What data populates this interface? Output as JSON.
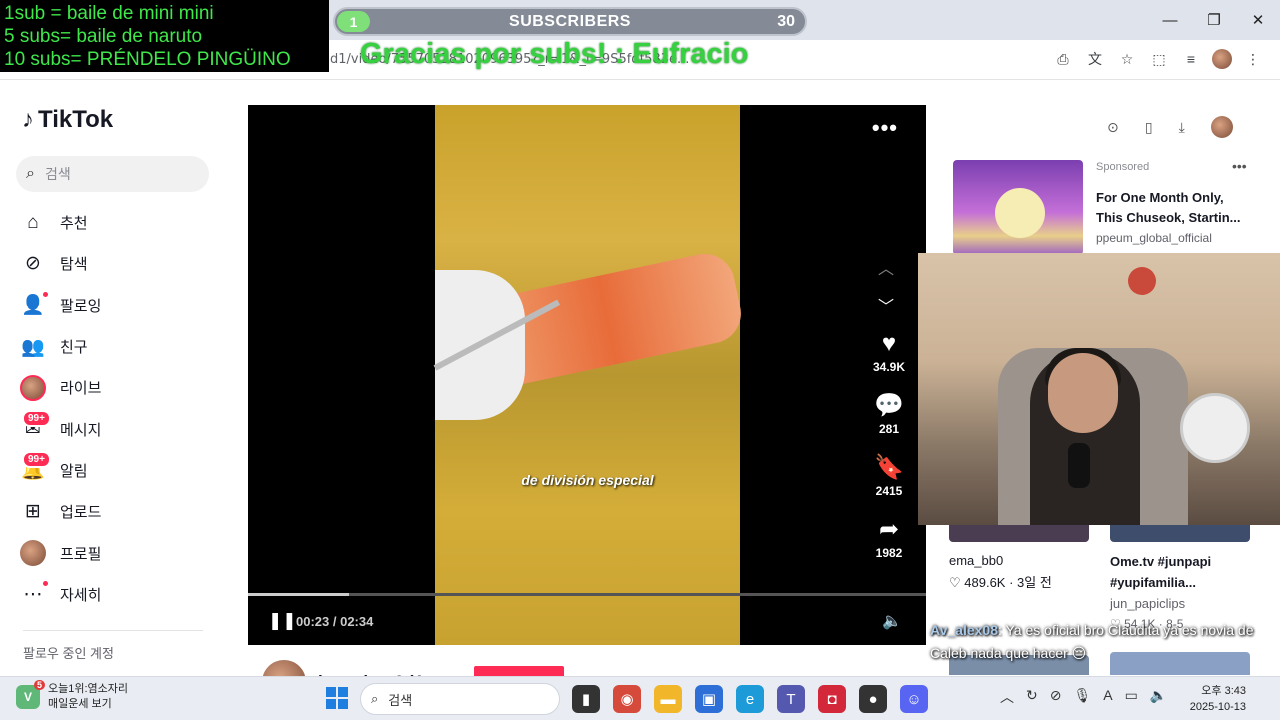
{
  "overlay": {
    "goals": [
      "1sub = baile de mini mini",
      "5 subs= baile de naruto",
      "10 subs= PRÉNDELO PINGÜINO"
    ],
    "subscribers": {
      "label": "SUBSCRIBERS",
      "current": "1",
      "goal": "30",
      "progress": 0.033
    },
    "thanks": "Gracias por subs! : Eufracio"
  },
  "browser": {
    "url": "d1/video/75570528102096395?_r=1&_t=9S5fdf583e..."
  },
  "tiktok": {
    "logo": "TikTok",
    "search_placeholder": "검색",
    "nav": [
      {
        "label": "추천",
        "icon": "home-icon"
      },
      {
        "label": "탐색",
        "icon": "compass-icon"
      },
      {
        "label": "팔로잉",
        "icon": "following-icon"
      },
      {
        "label": "친구",
        "icon": "friends-icon"
      },
      {
        "label": "라이브",
        "icon": "live-icon"
      },
      {
        "label": "메시지",
        "icon": "message-icon",
        "badge": "99+"
      },
      {
        "label": "알림",
        "icon": "notification-icon",
        "badge": "99+"
      },
      {
        "label": "업로드",
        "icon": "upload-icon"
      },
      {
        "label": "프로필",
        "icon": "profile-icon"
      },
      {
        "label": "자세히",
        "icon": "more-icon"
      }
    ],
    "following_header": "팔로우 중인 계정"
  },
  "video": {
    "caption": "de división especial",
    "likes": "34.9K",
    "comments": "281",
    "saves": "2415",
    "shares": "1982",
    "time": "00:23 / 02:34",
    "progress": 0.149,
    "author": "ingeniero3d1"
  },
  "sidebar_right": {
    "sponsored": "Sponsored",
    "ad_title": "For One Month Only, This Chuseok, Startin...",
    "ad_user": "ppeum_global_official",
    "video1_user": "ema_bb0",
    "video1_stats": "♡ 489.6K · 3일 전",
    "video2_title": "Ome.tv #junpapi #yupifamilia...",
    "video2_user": "jun_papiclips",
    "video2_stats": "♡ 54.1K · 8-5"
  },
  "chat": {
    "user": "Av_alex08",
    "message": ": Ya es oficial bro Claudita ya es novia de Caleb nada que hacer 😔"
  },
  "taskbar": {
    "weather_line1": "오늘1위:염소자리",
    "weather_line2": "매일운세 보기",
    "weather_badge": "5",
    "search": "검색",
    "time": "오후 3:43",
    "date": "2025-10-13"
  }
}
